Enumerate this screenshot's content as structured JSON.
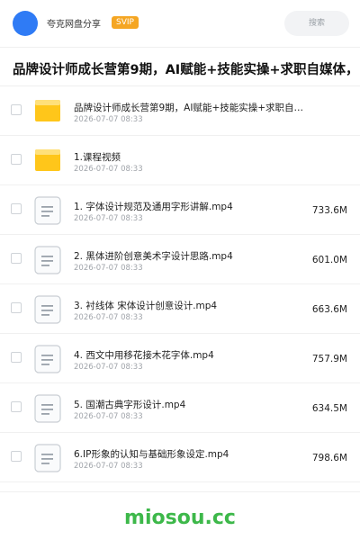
{
  "header": {
    "app_title": "夸克网盘分享",
    "badge": "SVIP",
    "search_placeholder": "搜索"
  },
  "page_title": "品牌设计师成长营第9期，AI赋能+技能实操+求职自媒体，",
  "files": [
    {
      "name": "品牌设计师成长营第9期，AI赋能+技能实操+求职自…",
      "date": "2026-07-07 08:33",
      "size": "",
      "type": "folder"
    },
    {
      "name": "1.课程视频",
      "date": "2026-07-07 08:33",
      "size": "",
      "type": "folder"
    },
    {
      "name": "1. 字体设计规范及通用字形讲解.mp4",
      "date": "2026-07-07 08:33",
      "size": "733.6M",
      "type": "file"
    },
    {
      "name": "2. 黑体进阶创意美术字设计思路.mp4",
      "date": "2026-07-07 08:33",
      "size": "601.0M",
      "type": "file"
    },
    {
      "name": "3. 衬线体 宋体设计创意设计.mp4",
      "date": "2026-07-07 08:33",
      "size": "663.6M",
      "type": "file"
    },
    {
      "name": "4. 西文中用移花接木花字体.mp4",
      "date": "2026-07-07 08:33",
      "size": "757.9M",
      "type": "file"
    },
    {
      "name": "5. 国潮古典字形设计.mp4",
      "date": "2026-07-07 08:33",
      "size": "634.5M",
      "type": "file"
    },
    {
      "name": "6.IP形象的认知与基础形象设定.mp4",
      "date": "2026-07-07 08:33",
      "size": "798.6M",
      "type": "file"
    }
  ],
  "icons": {
    "folder": "folder-icon",
    "file": "document-icon"
  },
  "colors": {
    "accent": "#2f7bf5",
    "badge": "#f5a623",
    "folder": "#ffc61a",
    "watermark": "#3db84a"
  },
  "watermark": "miosou.cc"
}
